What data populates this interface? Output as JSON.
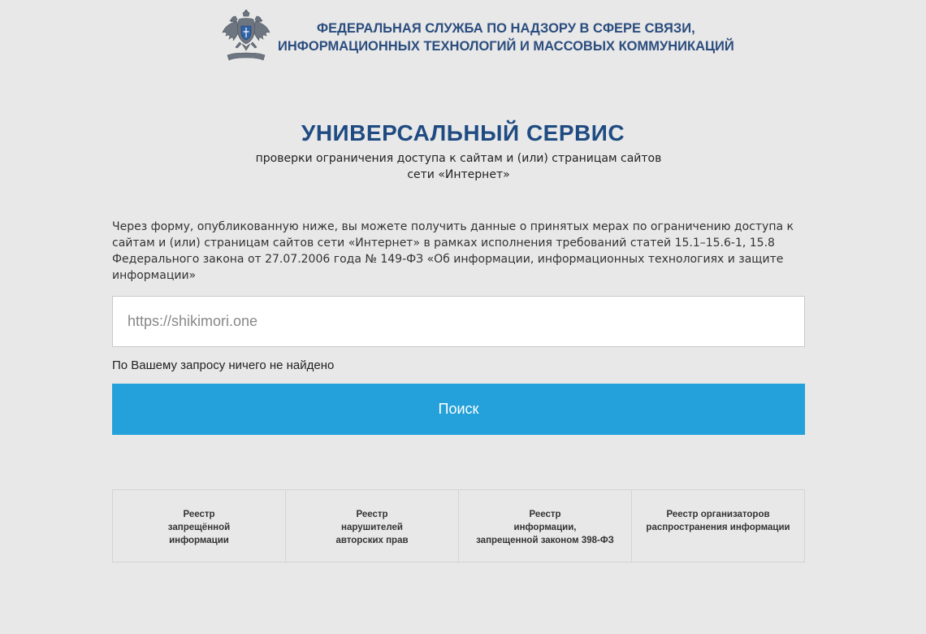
{
  "header": {
    "org_line1": "ФЕДЕРАЛЬНАЯ СЛУЖБА ПО НАДЗОРУ В СФЕРЕ СВЯЗИ,",
    "org_line2": "ИНФОРМАЦИОННЫХ ТЕХНОЛОГИЙ И МАССОВЫХ КОММУНИКАЦИЙ",
    "emblem_icon": "double-headed-eagle-emblem"
  },
  "main": {
    "title": "УНИВЕРСАЛЬНЫЙ СЕРВИС",
    "subtitle_line1": "проверки ограничения доступа к сайтам и (или) страницам сайтов",
    "subtitle_line2": "сети «Интернет»",
    "description": "Через форму, опубликованную ниже, вы можете получить данные о принятых мерах по ограничению доступа к сайтам и (или) страницам сайтов сети «Интернет» в рамках исполнения требований статей 15.1–15.6-1, 15.8 Федерального закона от 27.07.2006 года № 149-ФЗ «Об информации, информационных технологиях и защите информации»"
  },
  "search": {
    "value": "https://shikimori.one",
    "result": "По Вашему запросу ничего не найдено",
    "button_label": "Поиск"
  },
  "registries": [
    {
      "label": "Реестр\nзапрещённой\nинформации"
    },
    {
      "label": "Реестр\nнарушителей\nавторских прав"
    },
    {
      "label": "Реестр\nинформации,\nзапрещенной законом 398-ФЗ"
    },
    {
      "label": "Реестр организаторов\nраспространения информации"
    }
  ],
  "colors": {
    "background": "#e8e8e8",
    "title": "#1f4b82",
    "button": "#24a0da"
  }
}
